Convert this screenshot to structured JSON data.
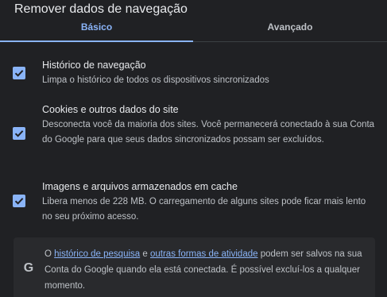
{
  "dialog": {
    "title": "Remover dados de navegação"
  },
  "tabs": [
    {
      "label": "Básico",
      "selected": true
    },
    {
      "label": "Avançado",
      "selected": false
    }
  ],
  "options": [
    {
      "checked": true,
      "title": "Histórico de navegação",
      "description": "Limpa o histórico de todos os dispositivos sincronizados"
    },
    {
      "checked": true,
      "title": "Cookies e outros dados do site",
      "description": "Desconecta você da maioria dos sites. Você permanecerá conectado à sua Conta do Google para que seus dados sincronizados possam ser excluídos."
    },
    {
      "checked": true,
      "title": "Imagens e arquivos armazenados em cache",
      "description": "Libera menos de 228 MB. O carregamento de alguns sites pode ficar mais lento no seu próximo acesso."
    }
  ],
  "info": {
    "icon": "google-g-icon",
    "prefix": "O ",
    "link1": "histórico de pesquisa",
    "middle": " e ",
    "link2": "outras formas de atividade",
    "suffix": " podem ser salvos na sua Conta do Google quando ela está conectada. É possível excluí-los a qualquer momento."
  },
  "colors": {
    "background": "#202124",
    "accent": "#8ab4f8",
    "text_primary": "#e8eaed",
    "text_secondary": "#bdc1c6",
    "info_box": "#292a2d"
  }
}
